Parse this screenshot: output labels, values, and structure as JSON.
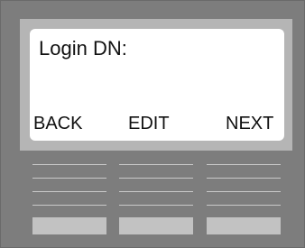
{
  "display": {
    "prompt": "Login DN:",
    "softkeys": {
      "back": "BACK",
      "edit": "EDIT",
      "next": "NEXT"
    }
  },
  "colors": {
    "housing": "#7d7d7d",
    "bezel": "#b5b5b5",
    "screen": "#ffffff",
    "grille": "#c9c9c9",
    "keys": "#c2c2c2"
  }
}
